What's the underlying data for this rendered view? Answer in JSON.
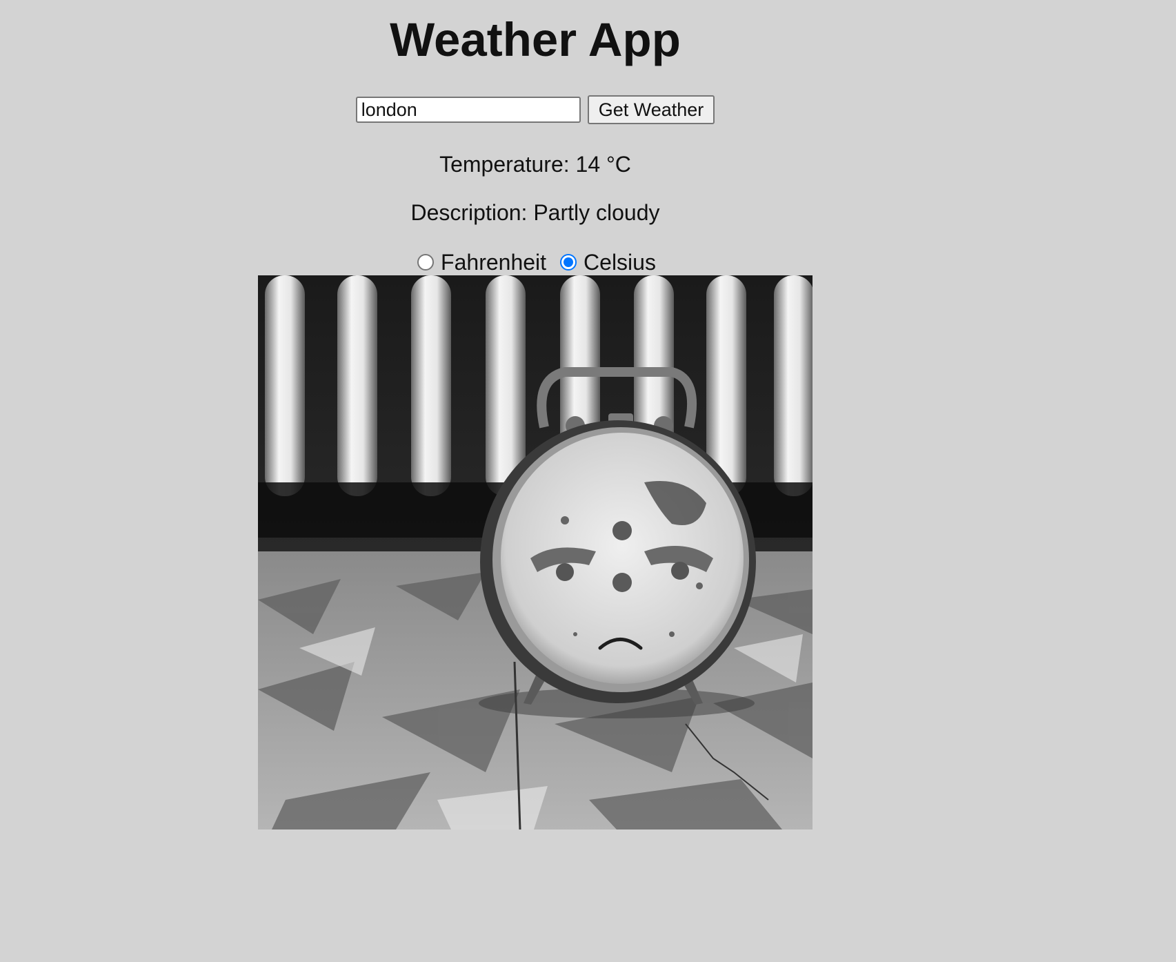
{
  "app": {
    "title": "Weather App"
  },
  "search": {
    "value": "london",
    "button_label": "Get Weather"
  },
  "weather": {
    "temperature_text": "Temperature: 14 °C",
    "description_text": "Description: Partly cloudy"
  },
  "units": {
    "options": [
      {
        "label": "Fahrenheit",
        "selected": false
      },
      {
        "label": "Celsius",
        "selected": true
      }
    ]
  },
  "image": {
    "subject": "sad-alarm-clock",
    "tone": "black-and-white"
  },
  "colors": {
    "page_background": "#d3d3d3",
    "radio_accent": "#0075ff"
  }
}
